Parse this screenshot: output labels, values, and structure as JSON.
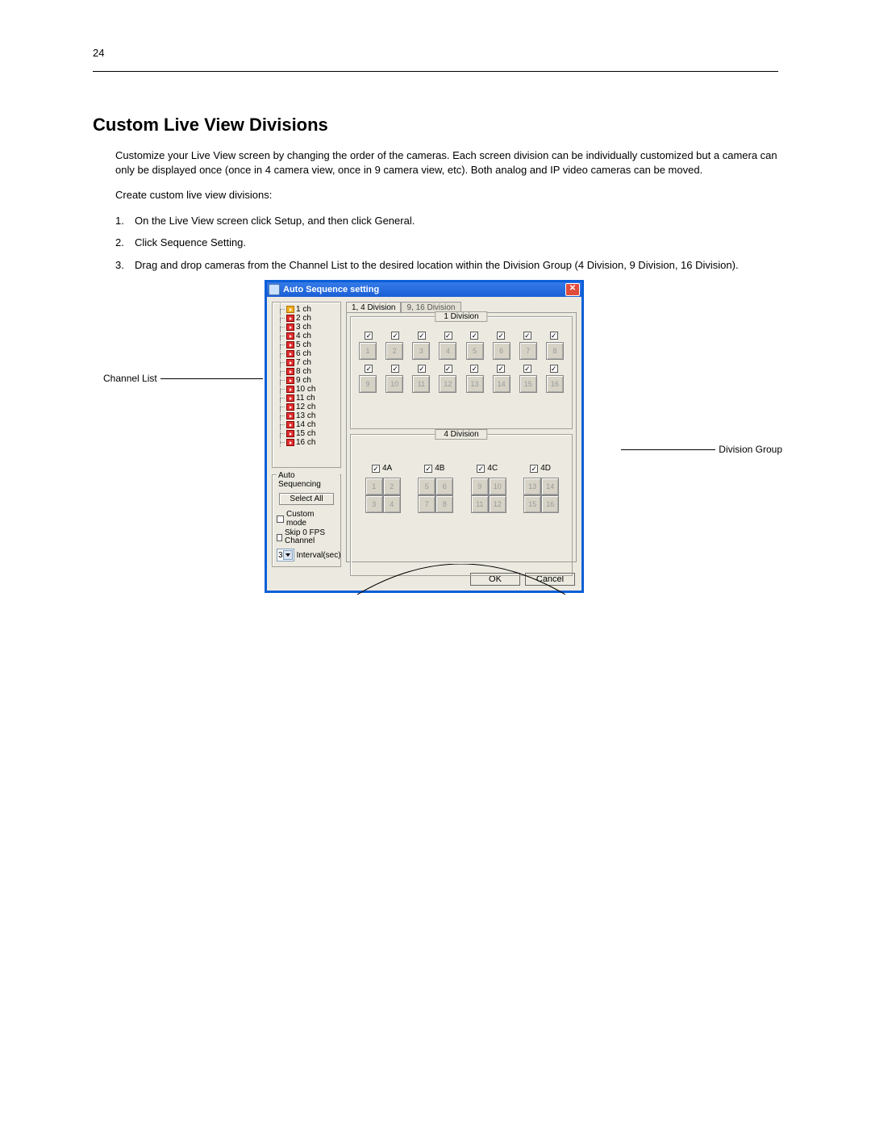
{
  "page_number": "24",
  "heading": "Custom Live View Divisions",
  "intro": "Customize your Live View screen by changing the order of the cameras. Each screen division can be individually customized but a camera can only be displayed once (once in 4 camera view, once in 9 camera view, etc). Both analog and IP video cameras can be moved.",
  "subhead": "Create custom live view divisions:",
  "steps": [
    "On the Live View screen click Setup, and then click General.",
    "Click Sequence Setting.",
    "Drag and drop cameras from the Channel List to the desired location within the Division Group (4 Division, 9 Division, 16 Division)."
  ],
  "callouts": {
    "channel_list": "Channel List",
    "division_group": "Division Group"
  },
  "dialog": {
    "title": "Auto Sequence setting",
    "close_glyph": "✕",
    "channels": [
      "1 ch",
      "2 ch",
      "3 ch",
      "4 ch",
      "5 ch",
      "6 ch",
      "7 ch",
      "8 ch",
      "9 ch",
      "10 ch",
      "11 ch",
      "12 ch",
      "13 ch",
      "14 ch",
      "15 ch",
      "16 ch"
    ],
    "auto_seq": {
      "group_label": "Auto Sequencing",
      "select_all": "Select All",
      "custom_mode": "Custom mode",
      "skip0": "Skip 0 FPS Channel",
      "interval_value": "3",
      "interval_label": "Interval(sec)"
    },
    "tabs": {
      "active": "1, 4 Division",
      "inactive": "9, 16 Division"
    },
    "one_div_label": "1 Division",
    "four_div_label": "4 Division",
    "four_groups": [
      "4A",
      "4B",
      "4C",
      "4D"
    ],
    "row1_slots": [
      "1",
      "2",
      "3",
      "4",
      "5",
      "6",
      "7",
      "8"
    ],
    "row2_slots": [
      "9",
      "10",
      "11",
      "12",
      "13",
      "14",
      "15",
      "16"
    ],
    "grid_a": [
      "1",
      "2",
      "3",
      "4"
    ],
    "grid_b": [
      "5",
      "6",
      "7",
      "8"
    ],
    "grid_c": [
      "9",
      "10",
      "11",
      "12"
    ],
    "grid_d": [
      "13",
      "14",
      "15",
      "16"
    ],
    "ok": "OK",
    "cancel": "Cancel"
  }
}
